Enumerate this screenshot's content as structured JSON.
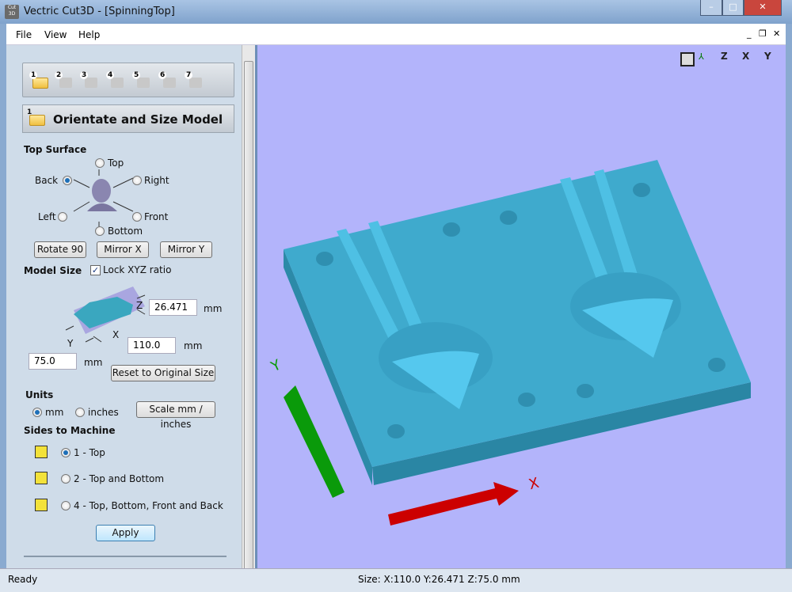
{
  "window": {
    "title": "Vectric Cut3D - [SpinningTop]",
    "app_icon": "Cut 3D"
  },
  "menu": [
    "File",
    "View",
    "Help"
  ],
  "steps": [
    "1",
    "2",
    "3",
    "4",
    "5",
    "6",
    "7"
  ],
  "section": {
    "number": "1",
    "title": "Orientate and Size Model"
  },
  "top_surface": {
    "label": "Top Surface",
    "options": {
      "top": "Top",
      "back": "Back",
      "right": "Right",
      "left": "Left",
      "front": "Front",
      "bottom": "Bottom"
    },
    "selected": "Back"
  },
  "buttons": {
    "rotate": "Rotate 90",
    "mirror_x": "Mirror X",
    "mirror_y": "Mirror Y",
    "reset": "Reset to Original Size",
    "scale": "Scale mm / inches",
    "apply": "Apply"
  },
  "model_size": {
    "label": "Model Size",
    "lock_label": "Lock XYZ ratio",
    "lock_checked": true,
    "z": "26.471",
    "x": "110.0",
    "y": "75.0",
    "unit": "mm",
    "axis_z": "Z",
    "axis_x": "X",
    "axis_y": "Y"
  },
  "units": {
    "label": "Units",
    "mm": "mm",
    "inches": "inches",
    "selected": "mm"
  },
  "sides": {
    "label": "Sides to Machine",
    "options": [
      "1 - Top",
      "2 - Top and Bottom",
      "4 - Top, Bottom, Front and Back"
    ],
    "selected": 0
  },
  "viewport": {
    "axis_x": "X",
    "axis_y": "Y",
    "view_icons": [
      "zoom-extents",
      "iso",
      "Z",
      "X",
      "Y"
    ],
    "background": "#b3b4fb",
    "model_color": "#3fa9cc"
  },
  "status": {
    "left": "Ready",
    "center": "Size: X:110.0 Y:26.471 Z:75.0 mm"
  }
}
